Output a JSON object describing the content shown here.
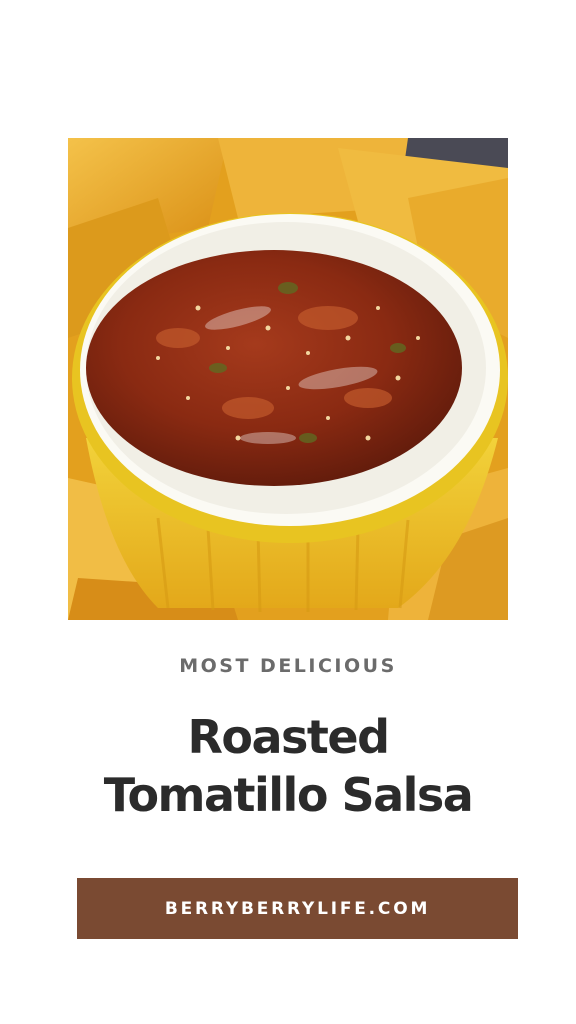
{
  "pin": {
    "eyebrow": "MOST DELICIOUS",
    "title_line1": "Roasted",
    "title_line2": "Tomatillo Salsa",
    "site_url": "BERRYBERRYLIFE.COM"
  },
  "photo": {
    "subject": "salsa-in-yellow-ramekin-with-tortilla-chips"
  },
  "colors": {
    "background": "#ffffff",
    "eyebrow": "#6b6b6b",
    "title": "#2b2b2b",
    "site_bar": "#7a4a32",
    "site_text": "#ffffff",
    "chips": "#e7a21f",
    "salsa": "#8a2a12",
    "ramekin_yellow": "#e9c21a"
  }
}
